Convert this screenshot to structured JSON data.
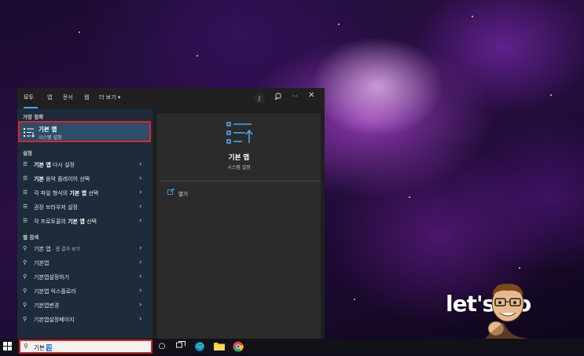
{
  "search_tabs": [
    {
      "label": "모두"
    },
    {
      "label": "앱"
    },
    {
      "label": "문서"
    },
    {
      "label": "웹"
    },
    {
      "label": "더 보기 ▾"
    }
  ],
  "header": {
    "avatar_initial": "J",
    "more_icon": "ellipsis-icon",
    "close_icon": "close-icon"
  },
  "best_match": {
    "section": "가장 정확",
    "title": "기본 앱",
    "subtitle": "시스템 설정"
  },
  "settings": {
    "section": "설정",
    "items": [
      {
        "bold": "기본 앱",
        "rest": " 다시 설정"
      },
      {
        "bold": "기본",
        "rest": " 음악 플레이어 선택"
      },
      {
        "pre": "각 파일 형식의 ",
        "bold": "기본 앱",
        "rest": " 선택"
      },
      {
        "bold": "",
        "rest": "권장 브라우저 설정"
      },
      {
        "pre": "각 프로토콜의 ",
        "bold": "기본 앱",
        "rest": " 선택"
      }
    ]
  },
  "web_search": {
    "section": "웹 검색",
    "items": [
      {
        "text": "기본 앱",
        "sub": " - 웹 결과 보기"
      },
      {
        "text": "기본앱",
        "sub": ""
      },
      {
        "text": "기본앱설정하기",
        "sub": ""
      },
      {
        "text": "기본앱 익스플로러",
        "sub": ""
      },
      {
        "text": "기본앱변경",
        "sub": ""
      },
      {
        "text": "기본앱설정페이지",
        "sub": ""
      }
    ]
  },
  "preview": {
    "title": "기본 앱",
    "subtitle": "시스템 설정",
    "open_label": "열기"
  },
  "taskbar": {
    "search_typed": "기본 ",
    "search_selected": "앱"
  },
  "sticker": {
    "text": "let's go"
  }
}
